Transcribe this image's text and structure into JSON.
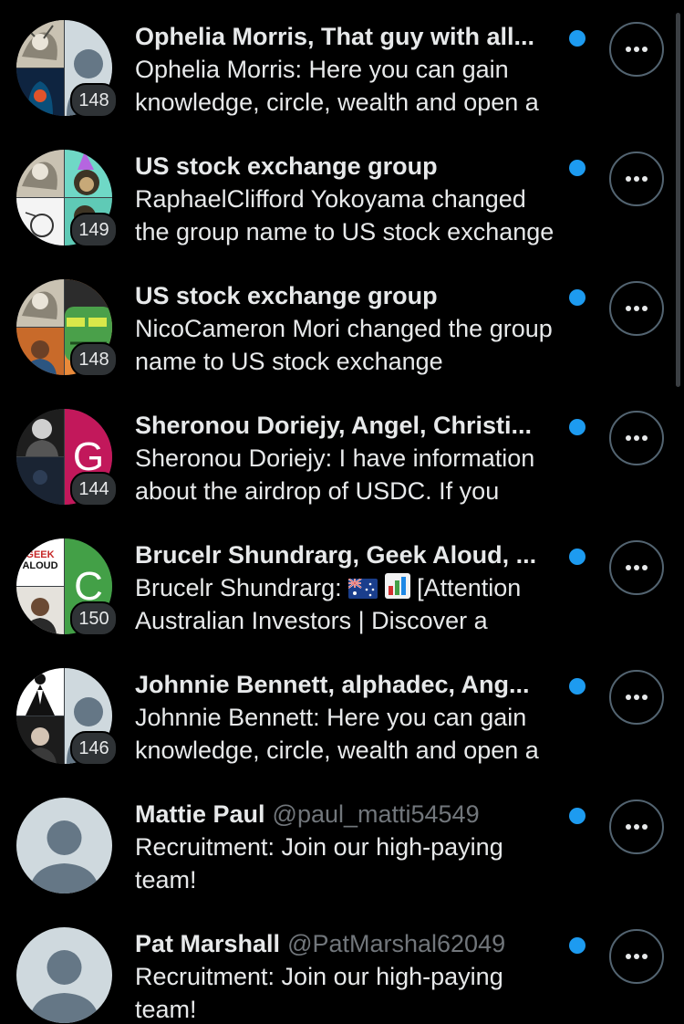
{
  "colors": {
    "background": "#000000",
    "text_primary": "#e7e9ea",
    "text_secondary": "#71767b",
    "unread_dot": "#1d9bf0",
    "badge_bg": "#2f3336",
    "button_border": "#536471"
  },
  "conversations": [
    {
      "title": "Ophelia Morris, That guy with all...",
      "handle": "",
      "preview": "Ophelia Morris: Here you can gain knowledge, circle, wealth and open a",
      "member_count": "148",
      "unread": true,
      "avatar_type": "group"
    },
    {
      "title": "US stock exchange group",
      "handle": "",
      "preview": "RaphaelClifford Yokoyama changed the group name to US stock exchange",
      "member_count": "149",
      "unread": true,
      "avatar_type": "group"
    },
    {
      "title": "US stock exchange group",
      "handle": "",
      "preview": "NicoCameron Mori changed the group name to US stock exchange",
      "member_count": "148",
      "unread": true,
      "avatar_type": "group"
    },
    {
      "title": "Sheronou Doriejy, Angel, Christi...",
      "handle": "",
      "preview": "Sheronou Doriejy: I have information about the airdrop of USDC. If you",
      "member_count": "144",
      "unread": true,
      "avatar_type": "group",
      "avatar_letter": "G"
    },
    {
      "title": "Brucelr Shundrarg, Geek Aloud, ...",
      "handle": "",
      "preview_prefix": "Brucelr Shundrarg:",
      "preview_suffix": "[Attention Australian Investors | Discover a",
      "member_count": "150",
      "unread": true,
      "avatar_type": "group",
      "avatar_letter": "C",
      "avatar_logo_text_1": "GEEK",
      "avatar_logo_text_2": "ALOUD",
      "preview_icons": [
        "australia-flag-icon",
        "bar-chart-icon"
      ]
    },
    {
      "title": "Johnnie Bennett, alphadec, Ang...",
      "handle": "",
      "preview": "Johnnie Bennett: Here you can gain knowledge, circle, wealth and open a",
      "member_count": "146",
      "unread": true,
      "avatar_type": "group"
    },
    {
      "title": "Mattie Paul",
      "handle": "@paul_matti54549",
      "preview": "Recruitment: Join our high-paying team!",
      "unread": true,
      "avatar_type": "default-user"
    },
    {
      "title": "Pat Marshall",
      "handle": "@PatMarshal62049",
      "preview": "Recruitment: Join our high-paying team!",
      "unread": true,
      "avatar_type": "default-user"
    }
  ],
  "icons": {
    "more": "more-horizontal-icon",
    "unread": "unread-dot",
    "default_avatar": "default-user-icon"
  }
}
